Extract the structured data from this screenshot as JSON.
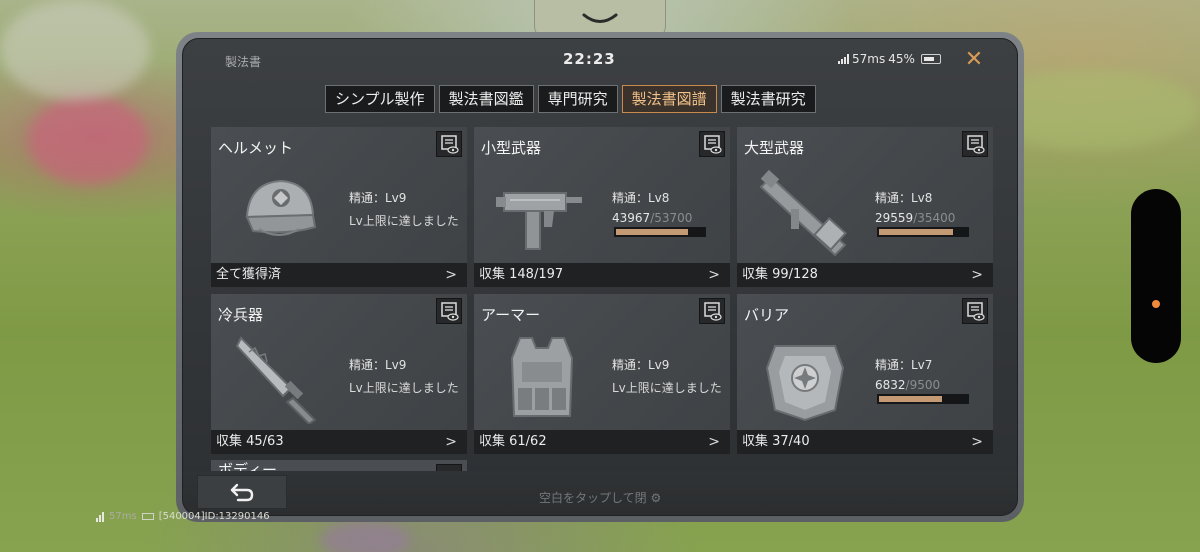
{
  "overlay": {
    "status_title": "製法書",
    "clock": "22:23",
    "network": "57ms",
    "battery": "45%",
    "close_icon": "close-icon"
  },
  "tabs": [
    {
      "label": "シンプル製作",
      "active": false
    },
    {
      "label": "製法書図鑑",
      "active": false
    },
    {
      "label": "専門研究",
      "active": false
    },
    {
      "label": "製法書図譜",
      "active": true
    },
    {
      "label": "製法書研究",
      "active": false
    }
  ],
  "cards": [
    {
      "title": "ヘルメット",
      "icon": "helmet-icon",
      "mastery": "精通：Lv9",
      "maxed": "Lv上限に達しました",
      "footer": "全て獲得済"
    },
    {
      "title": "小型武器",
      "icon": "smg-icon",
      "mastery": "精通：Lv8",
      "xp_current": "43967",
      "xp_sep": "/",
      "xp_max": "53700",
      "progress": 0.82,
      "footer": "収集 148/197"
    },
    {
      "title": "大型武器",
      "icon": "launcher-icon",
      "mastery": "精通：Lv8",
      "xp_current": "29559",
      "xp_sep": "/",
      "xp_max": "35400",
      "progress": 0.84,
      "footer": "収集 99/128"
    },
    {
      "title": "冷兵器",
      "icon": "blade-icon",
      "mastery": "精通：Lv9",
      "maxed": "Lv上限に達しました",
      "footer": "収集 45/63"
    },
    {
      "title": "アーマー",
      "icon": "armor-vest-icon",
      "mastery": "精通：Lv9",
      "maxed": "Lv上限に達しました",
      "footer": "収集 61/62"
    },
    {
      "title": "バリア",
      "icon": "barrier-icon",
      "mastery": "精通：Lv7",
      "xp_current": "6832",
      "xp_sep": "/",
      "xp_max": "9500",
      "progress": 0.72,
      "footer": "収集 37/40"
    }
  ],
  "partial_card": {
    "title": "ボディー"
  },
  "bottom": {
    "tap_hint": "空白をタップして閉"
  },
  "debug": {
    "ping": "57ms",
    "id": "[540004]ID:13290146"
  },
  "colors": {
    "accent": "#f0c08a",
    "progress_fill": "#c49a74",
    "close": "#d89a58"
  }
}
